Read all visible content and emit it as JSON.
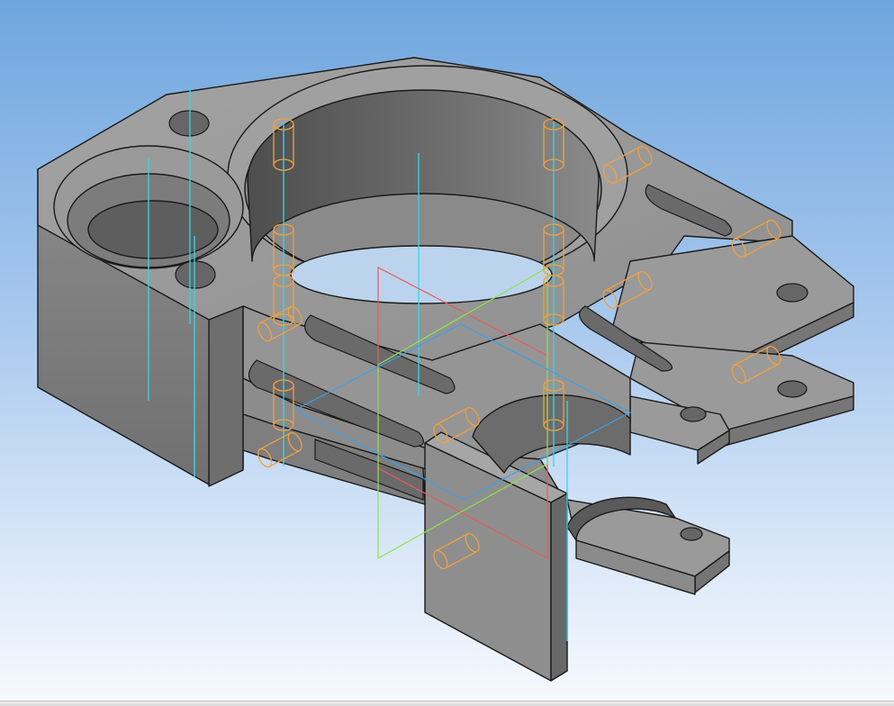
{
  "viewport": {
    "background_top": "#6fa6de",
    "background_bottom": "#f7fafe"
  },
  "model": {
    "face_top": "#9a9a9a",
    "face_side": "#7a7a7a",
    "face_dark": "#5c5c5c",
    "edge_color": "#1a1a1a",
    "axis_color": "#33d8ea",
    "pin_color": "#f0a040",
    "origin_plane_colors": [
      "#e85c5c",
      "#3ea0e8",
      "#8ee24a"
    ]
  }
}
